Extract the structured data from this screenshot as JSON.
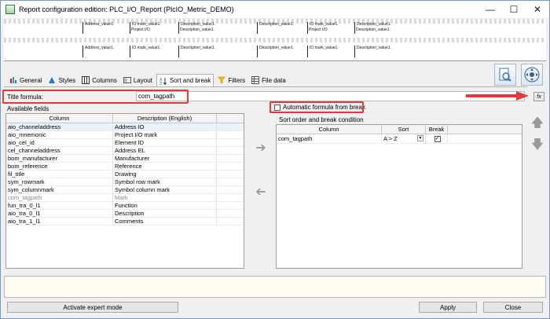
{
  "window": {
    "title": "Report configuration edition: PLC_I/O_Report (PlcIO_Metric_DEMO)",
    "controls": {
      "minimize": "—",
      "maximize": "☐",
      "close": "✕"
    }
  },
  "preview": {
    "rows": [
      [
        "Address_value1.",
        "IO mark_value1.",
        "Description_value1.",
        "Description_value1.",
        "IO mark_value1.",
        "Description_value1."
      ],
      [
        "Address_value1.",
        "IO mark_value1.",
        "Description_value1.",
        "Description_value1.",
        "IO mark_value1.",
        "Description_value1."
      ]
    ],
    "rows_line2": [
      "Project I/O",
      "Description_value1.",
      "Project I/O",
      "Description_value1."
    ]
  },
  "tabs": [
    {
      "label": "General",
      "icon": "general-icon"
    },
    {
      "label": "Styles",
      "icon": "styles-icon"
    },
    {
      "label": "Columns",
      "icon": "columns-icon"
    },
    {
      "label": "Layout",
      "icon": "layout-icon"
    },
    {
      "label": "Sort and break",
      "icon": "sort-icon",
      "active": true
    },
    {
      "label": "Filters",
      "icon": "filter-icon"
    },
    {
      "label": "File data",
      "icon": "file-data-icon"
    }
  ],
  "title_formula": {
    "label": "Title formula:",
    "value": "com_tagpath",
    "fx_label": "fx"
  },
  "available_fields": {
    "title": "Available fields",
    "columns": [
      "Column",
      "Description (English)"
    ],
    "rows": [
      [
        "aio_channeladdress",
        "Address IO",
        false
      ],
      [
        "aio_mnemonic",
        "Project I/O mark",
        false
      ],
      [
        "aio_cel_id",
        "Element ID",
        false
      ],
      [
        "cel_channeladdress",
        "Address EL",
        false
      ],
      [
        "bom_manufacturer",
        "Manufacturer",
        false
      ],
      [
        "bom_reference",
        "Reference",
        false
      ],
      [
        "fil_title",
        "Drawing",
        false
      ],
      [
        "sym_rowmark",
        "Symbol row mark",
        false
      ],
      [
        "sym_columnmark",
        "Symbol column mark",
        false
      ],
      [
        "com_tagpath",
        "Mark",
        true
      ],
      [
        "fun_tra_0_l1",
        "Function",
        false
      ],
      [
        "aio_tra_0_l1",
        "Description",
        false
      ],
      [
        "aio_tra_1_l1",
        "Comments",
        false
      ]
    ]
  },
  "auto_formula": {
    "label": "Automatic formula from break",
    "checked": false
  },
  "sort_order": {
    "title": "Sort order and break condition",
    "columns": [
      "Column",
      "Sort",
      "Break"
    ],
    "rows": [
      {
        "column": "com_tagpath",
        "sort": "A > Z",
        "break": true
      }
    ]
  },
  "buttons": {
    "expert": "Activate expert mode",
    "apply": "Apply",
    "close": "Close"
  },
  "colors": {
    "highlight": "#e03a3a",
    "accent": "#6f9bd1"
  }
}
